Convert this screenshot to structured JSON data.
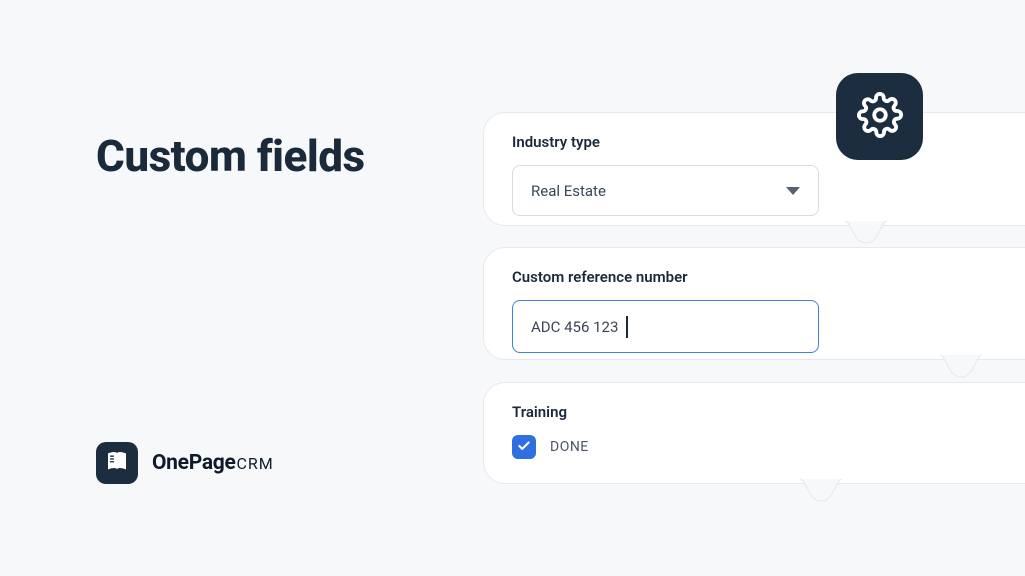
{
  "title": "Custom fields",
  "fields": {
    "industry": {
      "label": "Industry type",
      "value": "Real Estate"
    },
    "reference": {
      "label": "Custom reference number",
      "value": "ADC 456 123"
    },
    "training": {
      "label": "Training",
      "checkbox_label": "DONE",
      "checked": true
    }
  },
  "brand": {
    "name_primary": "OnePage",
    "name_secondary": "CRM"
  },
  "colors": {
    "dark": "#1b2d3e",
    "accent": "#2f6fe0",
    "focus": "#3f7fe8",
    "bg": "#f7f8fa"
  }
}
